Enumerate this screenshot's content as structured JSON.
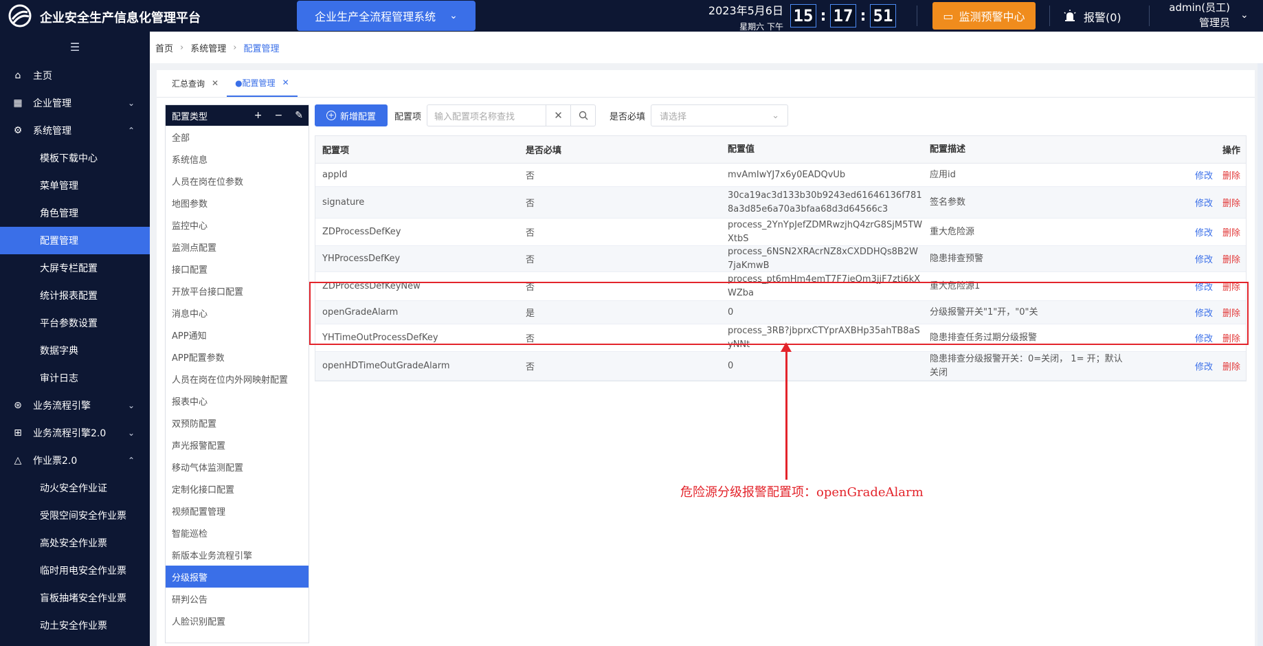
{
  "header": {
    "app_title": "企业安全生产信息化管理平台",
    "system_select": "企业生产全流程管理系统",
    "date": "2023年5月6日",
    "weekday_period": "星期六  下午",
    "clock": {
      "hour": "15",
      "minute": "17",
      "second": "51"
    },
    "monitor_button": "监测预警中心",
    "alarm_label": "报警(0)",
    "user_name": "admin(员工)",
    "user_role": "管理员"
  },
  "sidebar": {
    "items": [
      {
        "label": "主页",
        "icon": "home-icon"
      },
      {
        "label": "企业管理",
        "icon": "building-icon"
      },
      {
        "label": "系统管理",
        "icon": "settings-icon"
      }
    ],
    "system_sub": [
      "模板下载中心",
      "菜单管理",
      "角色管理",
      "配置管理",
      "大屏专栏配置",
      "统计报表配置",
      "平台参数设置",
      "数据字典",
      "审计日志"
    ],
    "items2": [
      {
        "label": "业务流程引擎",
        "icon": "flow-icon"
      },
      {
        "label": "业务流程引擎2.0",
        "icon": "hierarchy-icon"
      },
      {
        "label": "作业票2.0",
        "icon": "ticket-icon"
      }
    ],
    "ticket_sub": [
      "动火安全作业证",
      "受限空间安全作业票",
      "高处安全作业票",
      "临时用电安全作业票",
      "盲板抽堵安全作业票",
      "动土安全作业票"
    ]
  },
  "breadcrumb": [
    "首页",
    "系统管理",
    "配置管理"
  ],
  "tabs": [
    {
      "label": "汇总查询",
      "active": false
    },
    {
      "label": "●配置管理",
      "active": true
    }
  ],
  "type_panel": {
    "title": "配置类型",
    "items": [
      "全部",
      "系统信息",
      "人员在岗在位参数",
      "地图参数",
      "监控中心",
      "监测点配置",
      "接口配置",
      "开放平台接口配置",
      "消息中心",
      "APP通知",
      "APP配置参数",
      "人员在岗在位内外网映射配置",
      "报表中心",
      "双预防配置",
      "声光报警配置",
      "移动气体监测配置",
      "定制化接口配置",
      "视频配置管理",
      "智能巡检",
      "新版本业务流程引擎",
      "分级报警",
      "研判公告",
      "人脸识别配置"
    ],
    "active": "分级报警"
  },
  "toolbar": {
    "add_label": "新增配置",
    "config_item_label": "配置项",
    "search_placeholder": "输入配置项名称查找",
    "required_label": "是否必填",
    "select_placeholder": "请选择"
  },
  "table": {
    "headers": [
      "配置项",
      "是否必填",
      "配置值",
      "配置描述",
      "操作"
    ],
    "edit_label": "修改",
    "delete_label": "删除",
    "rows": [
      {
        "key": "appId",
        "required": "否",
        "value": "mvAmIwYJ7x6y0EADQvUb",
        "desc": "应用id"
      },
      {
        "key": "signature",
        "required": "否",
        "value": "30ca19ac3d133b30b9243ed61646136f7818a3d85e6a70a3bfaa68d3d64566c3",
        "desc": "签名参数"
      },
      {
        "key": "ZDProcessDefKey",
        "required": "否",
        "value": "process_2YnYpJefZDMRwzjhQ4zrG8SjM5TWXtbS",
        "desc": "重大危险源"
      },
      {
        "key": "YHProcessDefKey",
        "required": "否",
        "value": "process_6NSN2XRAcrNZ8xCXDDHQs8B2W7jaKmwB",
        "desc": "隐患排查预警"
      },
      {
        "key": "ZDProcessDefKeyNew",
        "required": "否",
        "value": "process_pt6mHm4emT7F7ieQm3jjF7zti6kXWZba",
        "desc": "重大危险源1"
      },
      {
        "key": "openGradeAlarm",
        "required": "是",
        "value": "0",
        "desc": "分级报警开关\"1\"开，\"0\"关"
      },
      {
        "key": "YHTimeOutProcessDefKey",
        "required": "否",
        "value": "process_3RB?jbprxCTYprAXBHp35ahTB8aSyNNt",
        "desc": "隐患排查任务过期分级报警"
      },
      {
        "key": "openHDTimeOutGradeAlarm",
        "required": "否",
        "value": "0",
        "desc": "隐患排查分级报警开关：0=关闭， 1= 开；默认关闭"
      }
    ]
  },
  "annotation": "危险源分级报警配置项：openGradeAlarm",
  "colors": {
    "primary": "#3a6fe8",
    "nav_bg": "#0d1733",
    "warning": "#f08c1d",
    "annotation": "#e3242b"
  }
}
